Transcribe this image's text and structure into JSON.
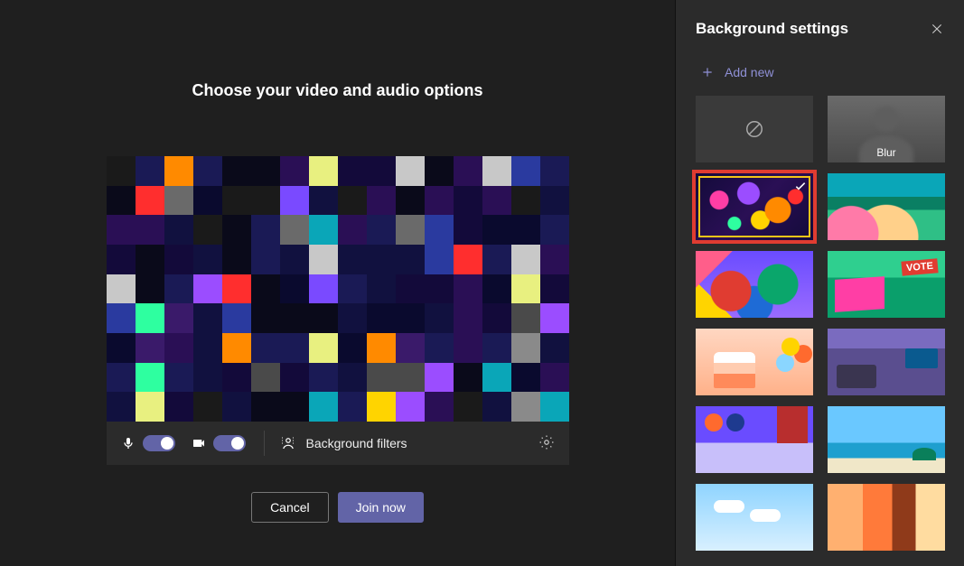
{
  "main": {
    "title": "Choose your video and audio options",
    "bg_filters_label": "Background filters",
    "cancel_label": "Cancel",
    "join_label": "Join now"
  },
  "toggles": {
    "mic_on": true,
    "camera_on": true
  },
  "panel": {
    "title": "Background settings",
    "add_new_label": "Add new",
    "blur_label": "Blur",
    "selected_index": 2,
    "items": [
      {
        "id": "none",
        "kind": "none"
      },
      {
        "id": "blur",
        "kind": "blur"
      },
      {
        "id": "bokeh-lights",
        "kind": "image"
      },
      {
        "id": "abstract-wave",
        "kind": "image"
      },
      {
        "id": "colorful-hands",
        "kind": "image"
      },
      {
        "id": "vote-collage",
        "kind": "image"
      },
      {
        "id": "birthday-cake",
        "kind": "image"
      },
      {
        "id": "living-room",
        "kind": "image"
      },
      {
        "id": "shapes-shelf",
        "kind": "image"
      },
      {
        "id": "tropical-beach",
        "kind": "image"
      },
      {
        "id": "blue-sky",
        "kind": "image"
      },
      {
        "id": "canyon",
        "kind": "image"
      }
    ]
  }
}
